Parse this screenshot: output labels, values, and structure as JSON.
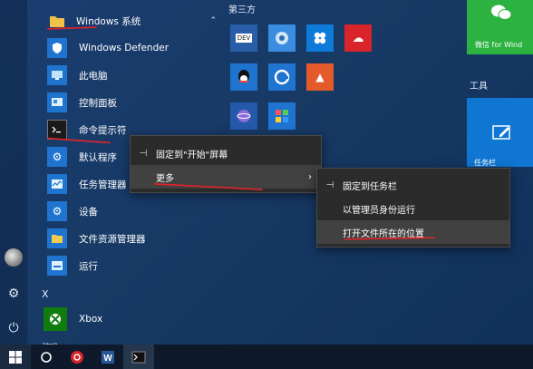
{
  "rail": {
    "settings_icon": "gear-icon",
    "power_icon": "power-icon"
  },
  "list": {
    "folder_label": "Windows 系统",
    "items": [
      {
        "label": "Windows Defender",
        "icon": "shield-icon"
      },
      {
        "label": "此电脑",
        "icon": "computer-icon"
      },
      {
        "label": "控制面板",
        "icon": "control-panel-icon"
      },
      {
        "label": "命令提示符",
        "icon": "cmd-icon"
      },
      {
        "label": "默认程序",
        "icon": "gear-icon"
      },
      {
        "label": "任务管理器",
        "icon": "task-manager-icon"
      },
      {
        "label": "设备",
        "icon": "gear-icon"
      },
      {
        "label": "文件资源管理器",
        "icon": "folder-icon"
      },
      {
        "label": "运行",
        "icon": "run-icon"
      }
    ],
    "section_x": "X",
    "xbox_label": "Xbox",
    "section_next": "游戏"
  },
  "tiles": {
    "group_third": "第三方",
    "group_tools": "工具",
    "wechat_label": "微信 for Wind",
    "tools_tile_label": "任务栏"
  },
  "context_menu": {
    "pin_start": "固定到\"开始\"屏幕",
    "more": "更多"
  },
  "sub_menu": {
    "pin_taskbar": "固定到任务栏",
    "run_admin": "以管理员身份运行",
    "open_location": "打开文件所在的位置"
  },
  "colors": {
    "accent": "#1f74cf",
    "menu_bg": "#2b2b2b",
    "annotation": "#d8242a"
  }
}
